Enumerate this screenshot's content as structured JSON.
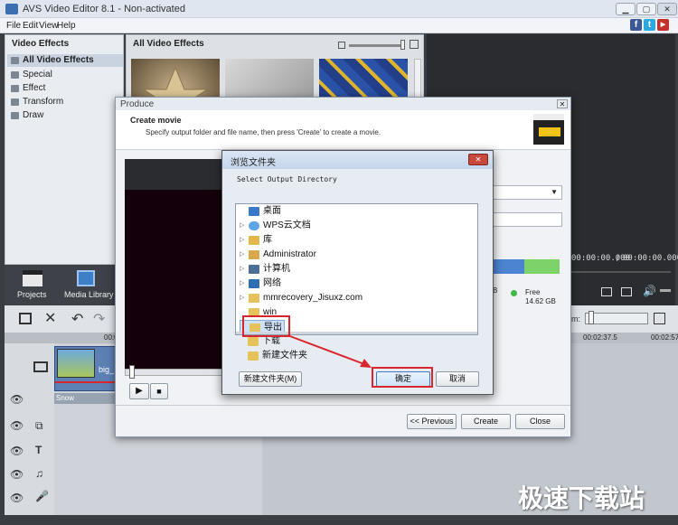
{
  "app": {
    "title": "AVS Video Editor 8.1 - Non-activated"
  },
  "window_buttons": {
    "minimize": "▁",
    "maximize": "▢",
    "close": "✕"
  },
  "menu": [
    "File",
    "Edit",
    "View",
    "Help"
  ],
  "social": {
    "facebook": "f",
    "twitter": "t",
    "youtube": "▶"
  },
  "left_panel": {
    "heading": "Video Effects",
    "categories": [
      "All Video Effects",
      "Special",
      "Effect",
      "Transform",
      "Draw"
    ]
  },
  "center_panel": {
    "heading": "All Video Effects"
  },
  "bottom_nav": {
    "projects": "Projects",
    "media_library": "Media Library"
  },
  "produce_dialog": {
    "title": "Produce",
    "heading": "Create movie",
    "description": "Specify output folder and file name, then press 'Create' to create a movie.",
    "free_label": "Free",
    "free_value": "14.62 GB",
    "partial_char": "B",
    "buttons": {
      "previous": "<< Previous",
      "create": "Create",
      "close": "Close"
    }
  },
  "browse_dialog": {
    "title": "浏览文件夹",
    "instruction": "Select Output Directory",
    "tree": [
      "桌面",
      "WPS云文档",
      "库",
      "Administrator",
      "计算机",
      "网络",
      "mmrecovery_Jisuxz.com",
      "win",
      "导出",
      "下载",
      "新建文件夹"
    ],
    "buttons": {
      "new_folder": "新建文件夹(M)",
      "ok": "确定",
      "cancel": "取消"
    }
  },
  "preview": {
    "time_current": "00:00:00.000",
    "time_total": "00:00:00.000"
  },
  "timeline": {
    "ruler": [
      "00:0",
      "00:02:37.5",
      "00:02:57"
    ],
    "clip_name": "big_",
    "effect_label": "Snow",
    "zoom_label": "m:"
  },
  "watermark": "极速下载站",
  "colors": {
    "accent": "#d9262c",
    "selection": "#cfe1f7",
    "free_space": "#7ed26a",
    "used_space": "#4c84d2"
  }
}
